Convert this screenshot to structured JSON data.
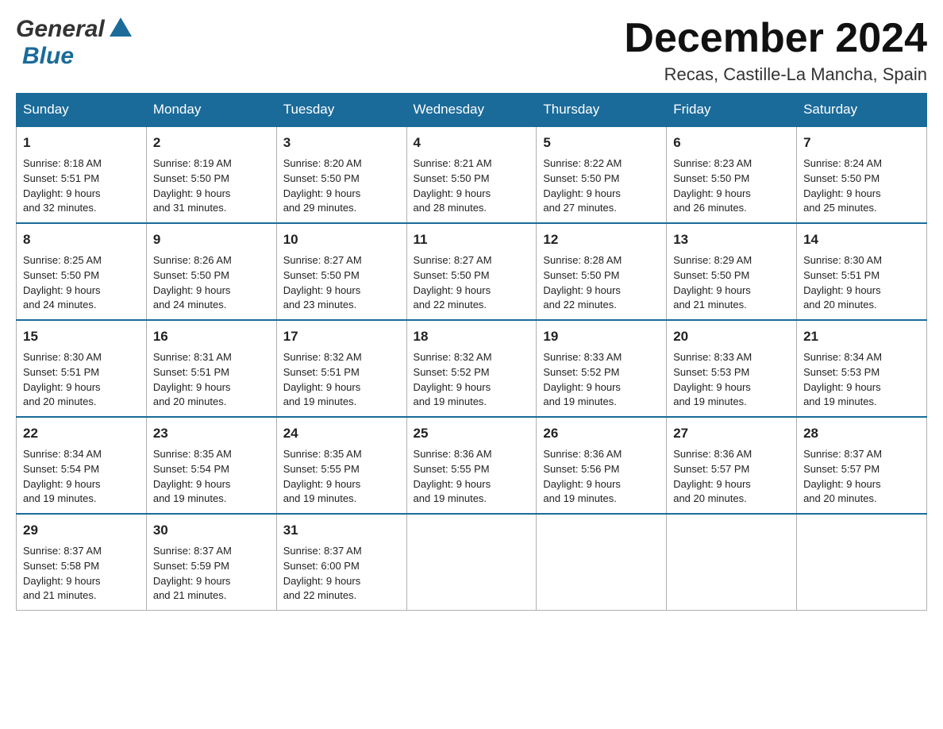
{
  "header": {
    "month_title": "December 2024",
    "location": "Recas, Castille-La Mancha, Spain",
    "logo_general": "General",
    "logo_blue": "Blue"
  },
  "days_of_week": [
    "Sunday",
    "Monday",
    "Tuesday",
    "Wednesday",
    "Thursday",
    "Friday",
    "Saturday"
  ],
  "weeks": [
    [
      {
        "day": 1,
        "sunrise": "8:18 AM",
        "sunset": "5:51 PM",
        "daylight": "9 hours and 32 minutes."
      },
      {
        "day": 2,
        "sunrise": "8:19 AM",
        "sunset": "5:50 PM",
        "daylight": "9 hours and 31 minutes."
      },
      {
        "day": 3,
        "sunrise": "8:20 AM",
        "sunset": "5:50 PM",
        "daylight": "9 hours and 29 minutes."
      },
      {
        "day": 4,
        "sunrise": "8:21 AM",
        "sunset": "5:50 PM",
        "daylight": "9 hours and 28 minutes."
      },
      {
        "day": 5,
        "sunrise": "8:22 AM",
        "sunset": "5:50 PM",
        "daylight": "9 hours and 27 minutes."
      },
      {
        "day": 6,
        "sunrise": "8:23 AM",
        "sunset": "5:50 PM",
        "daylight": "9 hours and 26 minutes."
      },
      {
        "day": 7,
        "sunrise": "8:24 AM",
        "sunset": "5:50 PM",
        "daylight": "9 hours and 25 minutes."
      }
    ],
    [
      {
        "day": 8,
        "sunrise": "8:25 AM",
        "sunset": "5:50 PM",
        "daylight": "9 hours and 24 minutes."
      },
      {
        "day": 9,
        "sunrise": "8:26 AM",
        "sunset": "5:50 PM",
        "daylight": "9 hours and 24 minutes."
      },
      {
        "day": 10,
        "sunrise": "8:27 AM",
        "sunset": "5:50 PM",
        "daylight": "9 hours and 23 minutes."
      },
      {
        "day": 11,
        "sunrise": "8:27 AM",
        "sunset": "5:50 PM",
        "daylight": "9 hours and 22 minutes."
      },
      {
        "day": 12,
        "sunrise": "8:28 AM",
        "sunset": "5:50 PM",
        "daylight": "9 hours and 22 minutes."
      },
      {
        "day": 13,
        "sunrise": "8:29 AM",
        "sunset": "5:50 PM",
        "daylight": "9 hours and 21 minutes."
      },
      {
        "day": 14,
        "sunrise": "8:30 AM",
        "sunset": "5:51 PM",
        "daylight": "9 hours and 20 minutes."
      }
    ],
    [
      {
        "day": 15,
        "sunrise": "8:30 AM",
        "sunset": "5:51 PM",
        "daylight": "9 hours and 20 minutes."
      },
      {
        "day": 16,
        "sunrise": "8:31 AM",
        "sunset": "5:51 PM",
        "daylight": "9 hours and 20 minutes."
      },
      {
        "day": 17,
        "sunrise": "8:32 AM",
        "sunset": "5:51 PM",
        "daylight": "9 hours and 19 minutes."
      },
      {
        "day": 18,
        "sunrise": "8:32 AM",
        "sunset": "5:52 PM",
        "daylight": "9 hours and 19 minutes."
      },
      {
        "day": 19,
        "sunrise": "8:33 AM",
        "sunset": "5:52 PM",
        "daylight": "9 hours and 19 minutes."
      },
      {
        "day": 20,
        "sunrise": "8:33 AM",
        "sunset": "5:53 PM",
        "daylight": "9 hours and 19 minutes."
      },
      {
        "day": 21,
        "sunrise": "8:34 AM",
        "sunset": "5:53 PM",
        "daylight": "9 hours and 19 minutes."
      }
    ],
    [
      {
        "day": 22,
        "sunrise": "8:34 AM",
        "sunset": "5:54 PM",
        "daylight": "9 hours and 19 minutes."
      },
      {
        "day": 23,
        "sunrise": "8:35 AM",
        "sunset": "5:54 PM",
        "daylight": "9 hours and 19 minutes."
      },
      {
        "day": 24,
        "sunrise": "8:35 AM",
        "sunset": "5:55 PM",
        "daylight": "9 hours and 19 minutes."
      },
      {
        "day": 25,
        "sunrise": "8:36 AM",
        "sunset": "5:55 PM",
        "daylight": "9 hours and 19 minutes."
      },
      {
        "day": 26,
        "sunrise": "8:36 AM",
        "sunset": "5:56 PM",
        "daylight": "9 hours and 19 minutes."
      },
      {
        "day": 27,
        "sunrise": "8:36 AM",
        "sunset": "5:57 PM",
        "daylight": "9 hours and 20 minutes."
      },
      {
        "day": 28,
        "sunrise": "8:37 AM",
        "sunset": "5:57 PM",
        "daylight": "9 hours and 20 minutes."
      }
    ],
    [
      {
        "day": 29,
        "sunrise": "8:37 AM",
        "sunset": "5:58 PM",
        "daylight": "9 hours and 21 minutes."
      },
      {
        "day": 30,
        "sunrise": "8:37 AM",
        "sunset": "5:59 PM",
        "daylight": "9 hours and 21 minutes."
      },
      {
        "day": 31,
        "sunrise": "8:37 AM",
        "sunset": "6:00 PM",
        "daylight": "9 hours and 22 minutes."
      },
      null,
      null,
      null,
      null
    ]
  ],
  "labels": {
    "sunrise": "Sunrise:",
    "sunset": "Sunset:",
    "daylight": "Daylight:"
  }
}
